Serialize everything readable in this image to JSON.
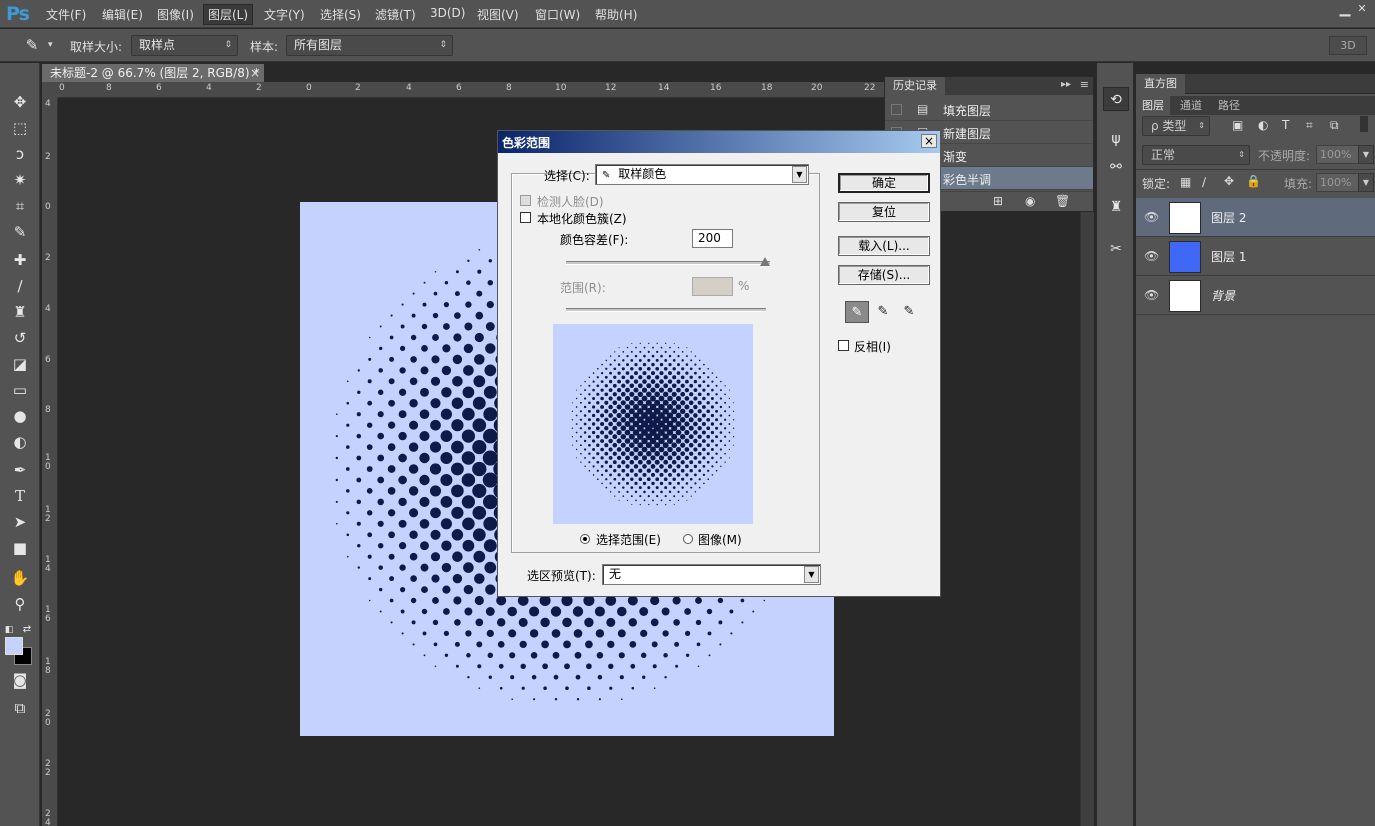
{
  "app": {
    "logo": "Ps",
    "menu": [
      "文件(F)",
      "编辑(E)",
      "图像(I)",
      "图层(L)",
      "文字(Y)",
      "选择(S)",
      "滤镜(T)",
      "3D(D)",
      "视图(V)",
      "窗口(W)",
      "帮助(H)"
    ],
    "active_menu_index": 3
  },
  "options_bar": {
    "sample_size_label": "取样大小:",
    "sample_size_value": "取样点",
    "sample_label": "样本:",
    "sample_value": "所有图层",
    "workspace": "3D"
  },
  "document": {
    "tab_title": "未标题-2 @ 66.7% (图层 2, RGB/8) *",
    "close": "×",
    "background_color": "#c6d2fe",
    "dot_color": "#0f1a4a"
  },
  "rulers": {
    "top": [
      "0",
      "8",
      "6",
      "4",
      "2",
      "0",
      "2",
      "4",
      "6",
      "8",
      "10",
      "12",
      "14",
      "16",
      "18",
      "20",
      "22"
    ],
    "left": [
      "4",
      "2",
      "0",
      "2",
      "4",
      "6",
      "8",
      "1 0",
      "1 2",
      "1 4",
      "1 6",
      "1 8",
      "2 0",
      "2 2",
      "2 4"
    ]
  },
  "history_panel": {
    "title": "历史记录",
    "items": [
      {
        "label": "填充图层",
        "selected": false
      },
      {
        "label": "新建图层",
        "selected": false
      },
      {
        "label": "渐变",
        "selected": false
      },
      {
        "label": "彩色半调",
        "selected": true
      }
    ]
  },
  "right_panel": {
    "histogram_title": "直方图",
    "tabs": [
      "图层",
      "通道",
      "路径"
    ],
    "filter_kind": "ρ 类型",
    "blend_mode": "正常",
    "opacity_label": "不透明度:",
    "opacity_value": "100%",
    "lock_label": "锁定:",
    "fill_label": "填充:",
    "fill_value": "100%",
    "layers": [
      {
        "name": "图层 2",
        "selected": true,
        "thumb_color": "#ffffff"
      },
      {
        "name": "图层 1",
        "selected": false,
        "thumb_color": "#3f68f6"
      },
      {
        "name": "背景",
        "selected": false,
        "thumb_color": "#ffffff"
      }
    ]
  },
  "dialog": {
    "title": "色彩范围",
    "close": "×",
    "select_label": "选择(C):",
    "select_value": "取样颜色",
    "detect_faces": "检测人脸(D)",
    "localized_clusters": "本地化颜色簇(Z)",
    "fuzziness_label": "颜色容差(F):",
    "fuzziness_value": "200",
    "range_label": "范围(R):",
    "range_unit": "%",
    "view_selection": "选择范围(E)",
    "view_image": "图像(M)",
    "preview_label": "选区预览(T):",
    "preview_value": "无",
    "buttons": {
      "ok": "确定",
      "reset": "复位",
      "load": "载入(L)...",
      "save": "存储(S)..."
    },
    "invert": "反相(I)"
  }
}
